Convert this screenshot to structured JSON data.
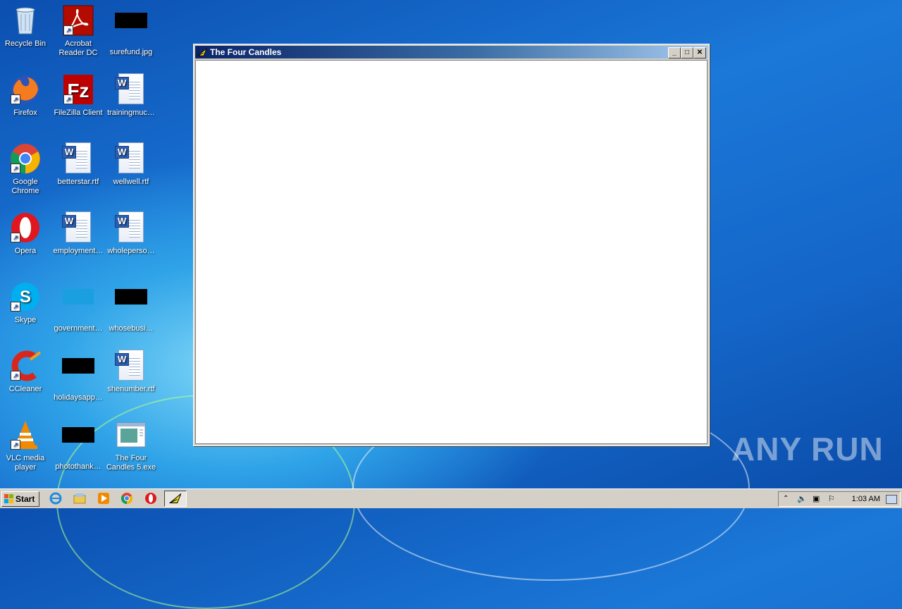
{
  "desktop": {
    "icons": [
      {
        "label": "Recycle Bin"
      },
      {
        "label": "Acrobat Reader DC"
      },
      {
        "label": "surefund.jpg"
      },
      {
        "label": "Firefox"
      },
      {
        "label": "FileZilla Client"
      },
      {
        "label": "trainingmuc…"
      },
      {
        "label": "Google Chrome"
      },
      {
        "label": "betterstar.rtf"
      },
      {
        "label": "wellwell.rtf"
      },
      {
        "label": "Opera"
      },
      {
        "label": "employment…"
      },
      {
        "label": "wholeperso…"
      },
      {
        "label": "Skype"
      },
      {
        "label": "government…"
      },
      {
        "label": "whosebusi…"
      },
      {
        "label": "CCleaner"
      },
      {
        "label": "holidaysapp…"
      },
      {
        "label": "shenumber.rtf"
      },
      {
        "label": "VLC media player"
      },
      {
        "label": "photothank…"
      },
      {
        "label": "The Four Candles 5.exe"
      }
    ]
  },
  "window": {
    "title": "The Four Candles",
    "minimize": "_",
    "maximize": "□",
    "close": "✕"
  },
  "taskbar": {
    "start_label": "Start",
    "clock": "1:03 AM",
    "pinned": [
      "internet-explorer-icon",
      "folder-icon",
      "media-player-icon",
      "chrome-icon",
      "opera-icon"
    ]
  },
  "watermark": "ANY RUN",
  "colors": {
    "titlebar_start": "#0a246a",
    "titlebar_end": "#a6caf0",
    "desktop": "#1466c8"
  }
}
